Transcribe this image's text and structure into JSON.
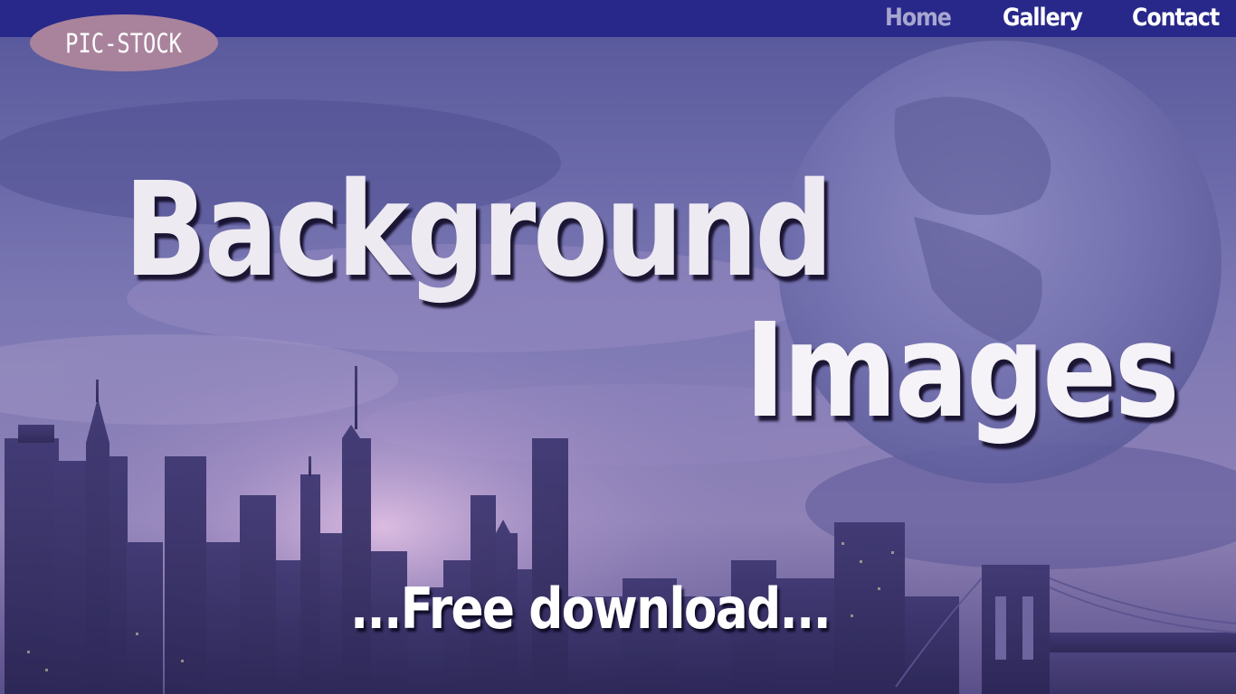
{
  "brand": {
    "logo_text": "PIC-STOCK"
  },
  "nav": {
    "items": [
      {
        "label": "Home",
        "active": true
      },
      {
        "label": "Gallery",
        "active": false
      },
      {
        "label": "Contact",
        "active": false
      }
    ]
  },
  "hero": {
    "headline_line1": "Background",
    "headline_line2": "Images",
    "tagline": "...Free download..."
  },
  "colors": {
    "navbar": "#28288a",
    "nav_active": "#a7a6cf",
    "nav_text": "#ffffff",
    "logo_bg": "#a9839c",
    "sky": "#6f6aa8"
  }
}
